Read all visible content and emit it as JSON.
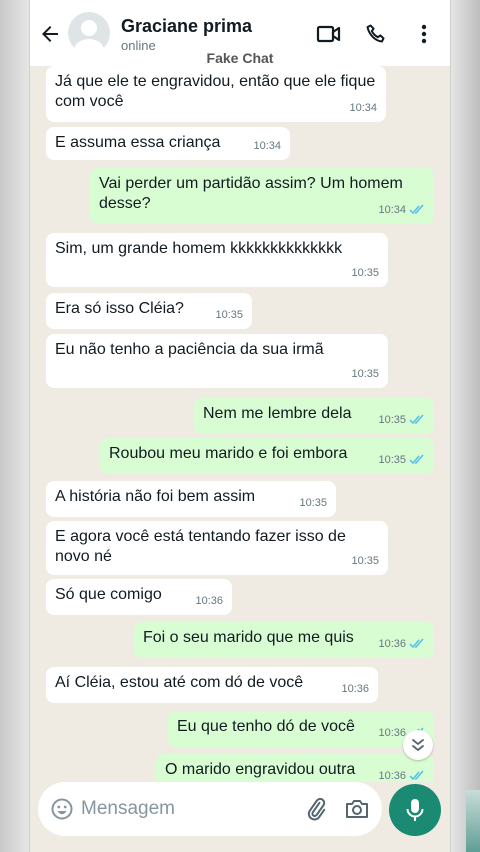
{
  "header": {
    "contact_name": "Graciane prima",
    "status": "online",
    "watermark": "Fake Chat",
    "icons": [
      "back-arrow-icon",
      "avatar",
      "video-call-icon",
      "phone-icon",
      "more-vert-icon"
    ]
  },
  "messages": [
    {
      "dir": "in",
      "text": "Já que ele te engravidou, então que ele fique com você",
      "time": "10:34"
    },
    {
      "dir": "in",
      "text": "E assuma essa criança",
      "time": "10:34"
    },
    {
      "dir": "out",
      "text": "Vai perder um partidão assim? Um homem desse?",
      "time": "10:34",
      "read": true
    },
    {
      "dir": "in",
      "text": "Sim, um grande homem kkkkkkkkkkkkkk",
      "time": "10:35"
    },
    {
      "dir": "in",
      "text": "Era só isso Cléia?",
      "time": "10:35"
    },
    {
      "dir": "in",
      "text": "Eu não tenho a paciência da sua irmã",
      "time": "10:35"
    },
    {
      "dir": "out",
      "text": "Nem me lembre dela",
      "time": "10:35",
      "read": true
    },
    {
      "dir": "out",
      "text": "Roubou meu marido e foi embora",
      "time": "10:35",
      "read": true
    },
    {
      "dir": "in",
      "text": "A história não foi bem assim",
      "time": "10:35"
    },
    {
      "dir": "in",
      "text": "E agora você está tentando fazer isso de novo né",
      "time": "10:35"
    },
    {
      "dir": "in",
      "text": "Só que comigo",
      "time": "10:36"
    },
    {
      "dir": "out",
      "text": "Foi o seu marido que me quis",
      "time": "10:36",
      "read": true
    },
    {
      "dir": "in",
      "text": "Aí Cléia, estou até com dó de você",
      "time": "10:36"
    },
    {
      "dir": "out",
      "text": "Eu que tenho dó de você",
      "time": "10:36",
      "read": true
    },
    {
      "dir": "out",
      "text": "O marido engravidou outra",
      "time": "10:36",
      "read": true
    }
  ],
  "input": {
    "placeholder": "Mensagem",
    "icons": [
      "emoji-icon",
      "attach-icon",
      "camera-icon",
      "mic-icon",
      "scroll-down-icon"
    ]
  },
  "colors": {
    "chat_bg": "#efeae2",
    "incoming": "#ffffff",
    "outgoing": "#d9fdd3",
    "read_ticks": "#53bdeb",
    "accent": "#1a8a73"
  }
}
